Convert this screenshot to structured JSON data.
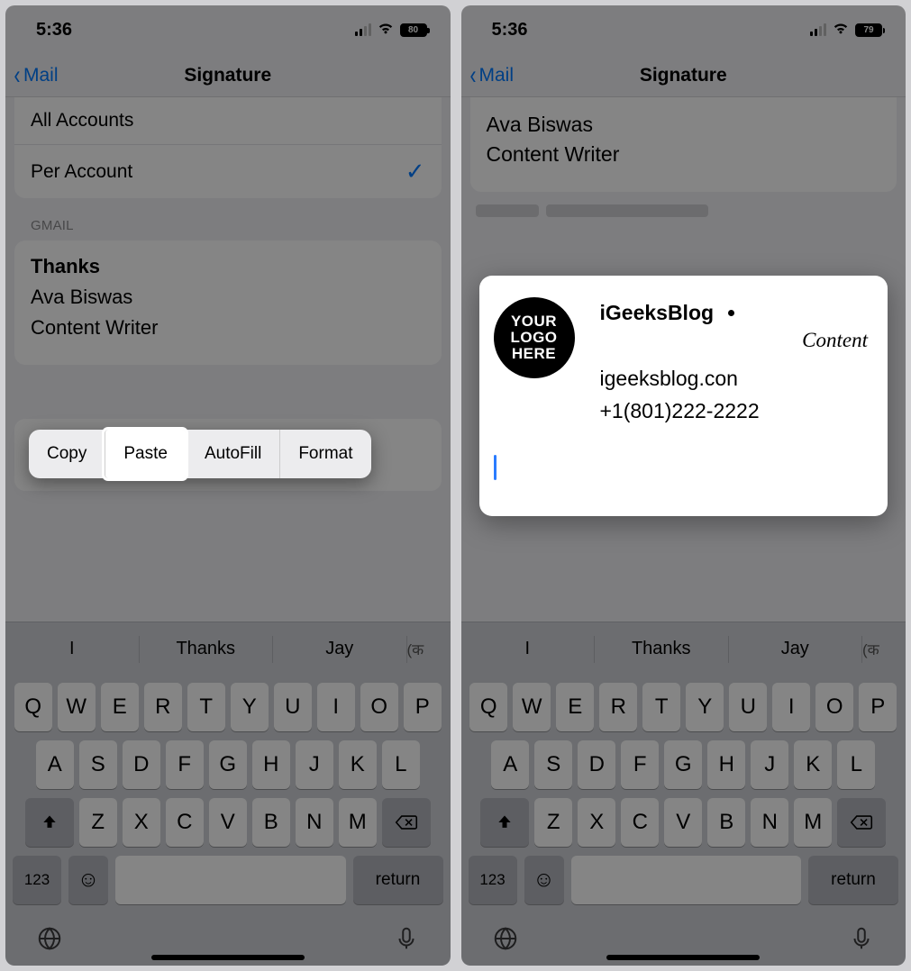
{
  "left": {
    "status": {
      "time": "5:36",
      "battery": "80"
    },
    "nav": {
      "back": "Mail",
      "title": "Signature"
    },
    "rows": {
      "all": "All Accounts",
      "per": "Per Account"
    },
    "section": "GMAIL",
    "sig": {
      "thanks": "Thanks",
      "name": "Ava Biswas",
      "role": "Content Writer"
    },
    "ctx": {
      "copy": "Copy",
      "paste": "Paste",
      "autofill": "AutoFill",
      "format": "Format"
    }
  },
  "right": {
    "status": {
      "time": "5:36",
      "battery": "79"
    },
    "nav": {
      "back": "Mail",
      "title": "Signature"
    },
    "sigtop": {
      "name": "Ava Biswas",
      "role": "Content Writer"
    },
    "paste": {
      "logo1": "YOUR",
      "logo2": "LOGO",
      "logo3": "HERE",
      "brand": "iGeeksBlog",
      "content": "Content",
      "site": "igeeksblog.con",
      "phone": "+1(801)222-2222"
    }
  },
  "predict": {
    "a": "I",
    "b": "Thanks",
    "c": "Jay",
    "lang": "(क"
  },
  "kbd": {
    "r1": [
      "Q",
      "W",
      "E",
      "R",
      "T",
      "Y",
      "U",
      "I",
      "O",
      "P"
    ],
    "r2": [
      "A",
      "S",
      "D",
      "F",
      "G",
      "H",
      "J",
      "K",
      "L"
    ],
    "r3": [
      "Z",
      "X",
      "C",
      "V",
      "B",
      "N",
      "M"
    ],
    "num": "123",
    "ret": "return"
  }
}
